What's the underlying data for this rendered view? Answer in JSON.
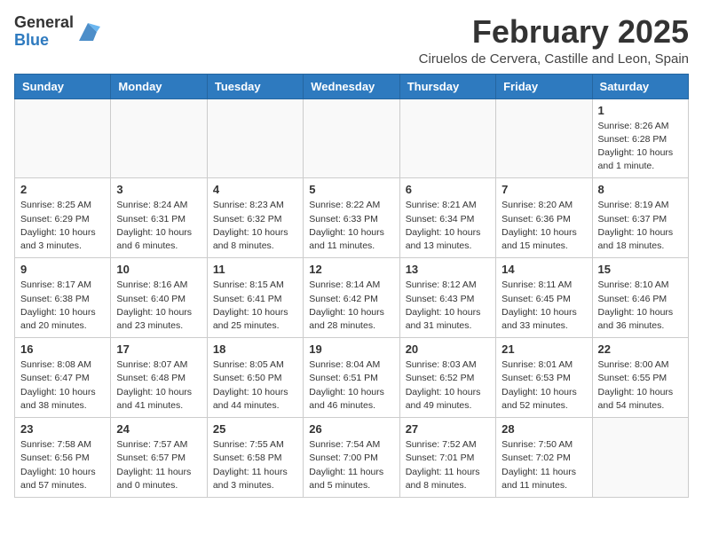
{
  "header": {
    "logo_general": "General",
    "logo_blue": "Blue",
    "month_year": "February 2025",
    "location": "Ciruelos de Cervera, Castille and Leon, Spain"
  },
  "weekdays": [
    "Sunday",
    "Monday",
    "Tuesday",
    "Wednesday",
    "Thursday",
    "Friday",
    "Saturday"
  ],
  "weeks": [
    [
      {
        "day": "",
        "info": ""
      },
      {
        "day": "",
        "info": ""
      },
      {
        "day": "",
        "info": ""
      },
      {
        "day": "",
        "info": ""
      },
      {
        "day": "",
        "info": ""
      },
      {
        "day": "",
        "info": ""
      },
      {
        "day": "1",
        "info": "Sunrise: 8:26 AM\nSunset: 6:28 PM\nDaylight: 10 hours\nand 1 minute."
      }
    ],
    [
      {
        "day": "2",
        "info": "Sunrise: 8:25 AM\nSunset: 6:29 PM\nDaylight: 10 hours\nand 3 minutes."
      },
      {
        "day": "3",
        "info": "Sunrise: 8:24 AM\nSunset: 6:31 PM\nDaylight: 10 hours\nand 6 minutes."
      },
      {
        "day": "4",
        "info": "Sunrise: 8:23 AM\nSunset: 6:32 PM\nDaylight: 10 hours\nand 8 minutes."
      },
      {
        "day": "5",
        "info": "Sunrise: 8:22 AM\nSunset: 6:33 PM\nDaylight: 10 hours\nand 11 minutes."
      },
      {
        "day": "6",
        "info": "Sunrise: 8:21 AM\nSunset: 6:34 PM\nDaylight: 10 hours\nand 13 minutes."
      },
      {
        "day": "7",
        "info": "Sunrise: 8:20 AM\nSunset: 6:36 PM\nDaylight: 10 hours\nand 15 minutes."
      },
      {
        "day": "8",
        "info": "Sunrise: 8:19 AM\nSunset: 6:37 PM\nDaylight: 10 hours\nand 18 minutes."
      }
    ],
    [
      {
        "day": "9",
        "info": "Sunrise: 8:17 AM\nSunset: 6:38 PM\nDaylight: 10 hours\nand 20 minutes."
      },
      {
        "day": "10",
        "info": "Sunrise: 8:16 AM\nSunset: 6:40 PM\nDaylight: 10 hours\nand 23 minutes."
      },
      {
        "day": "11",
        "info": "Sunrise: 8:15 AM\nSunset: 6:41 PM\nDaylight: 10 hours\nand 25 minutes."
      },
      {
        "day": "12",
        "info": "Sunrise: 8:14 AM\nSunset: 6:42 PM\nDaylight: 10 hours\nand 28 minutes."
      },
      {
        "day": "13",
        "info": "Sunrise: 8:12 AM\nSunset: 6:43 PM\nDaylight: 10 hours\nand 31 minutes."
      },
      {
        "day": "14",
        "info": "Sunrise: 8:11 AM\nSunset: 6:45 PM\nDaylight: 10 hours\nand 33 minutes."
      },
      {
        "day": "15",
        "info": "Sunrise: 8:10 AM\nSunset: 6:46 PM\nDaylight: 10 hours\nand 36 minutes."
      }
    ],
    [
      {
        "day": "16",
        "info": "Sunrise: 8:08 AM\nSunset: 6:47 PM\nDaylight: 10 hours\nand 38 minutes."
      },
      {
        "day": "17",
        "info": "Sunrise: 8:07 AM\nSunset: 6:48 PM\nDaylight: 10 hours\nand 41 minutes."
      },
      {
        "day": "18",
        "info": "Sunrise: 8:05 AM\nSunset: 6:50 PM\nDaylight: 10 hours\nand 44 minutes."
      },
      {
        "day": "19",
        "info": "Sunrise: 8:04 AM\nSunset: 6:51 PM\nDaylight: 10 hours\nand 46 minutes."
      },
      {
        "day": "20",
        "info": "Sunrise: 8:03 AM\nSunset: 6:52 PM\nDaylight: 10 hours\nand 49 minutes."
      },
      {
        "day": "21",
        "info": "Sunrise: 8:01 AM\nSunset: 6:53 PM\nDaylight: 10 hours\nand 52 minutes."
      },
      {
        "day": "22",
        "info": "Sunrise: 8:00 AM\nSunset: 6:55 PM\nDaylight: 10 hours\nand 54 minutes."
      }
    ],
    [
      {
        "day": "23",
        "info": "Sunrise: 7:58 AM\nSunset: 6:56 PM\nDaylight: 10 hours\nand 57 minutes."
      },
      {
        "day": "24",
        "info": "Sunrise: 7:57 AM\nSunset: 6:57 PM\nDaylight: 11 hours\nand 0 minutes."
      },
      {
        "day": "25",
        "info": "Sunrise: 7:55 AM\nSunset: 6:58 PM\nDaylight: 11 hours\nand 3 minutes."
      },
      {
        "day": "26",
        "info": "Sunrise: 7:54 AM\nSunset: 7:00 PM\nDaylight: 11 hours\nand 5 minutes."
      },
      {
        "day": "27",
        "info": "Sunrise: 7:52 AM\nSunset: 7:01 PM\nDaylight: 11 hours\nand 8 minutes."
      },
      {
        "day": "28",
        "info": "Sunrise: 7:50 AM\nSunset: 7:02 PM\nDaylight: 11 hours\nand 11 minutes."
      },
      {
        "day": "",
        "info": ""
      }
    ]
  ]
}
